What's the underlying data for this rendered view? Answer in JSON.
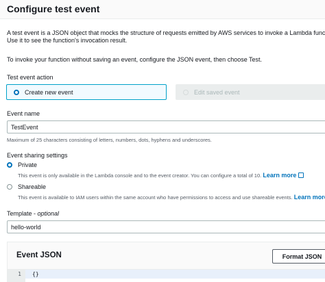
{
  "modal": {
    "title": "Configure test event"
  },
  "intro": {
    "line1": "A test event is a JSON object that mocks the structure of requests emitted by AWS services to invoke a Lambda function.",
    "line2": "Use it to see the function's invocation result.",
    "line3": "To invoke your function without saving an event, configure the JSON event, then choose Test."
  },
  "test_event_action": {
    "label": "Test event action",
    "options": [
      {
        "label": "Create new event",
        "selected": true,
        "disabled": false
      },
      {
        "label": "Edit saved event",
        "selected": false,
        "disabled": true
      }
    ]
  },
  "event_name": {
    "label": "Event name",
    "value": "TestEvent",
    "hint": "Maximum of 25 characters consisting of letters, numbers, dots, hyphens and underscores."
  },
  "sharing": {
    "label": "Event sharing settings",
    "private": {
      "label": "Private",
      "selected": true,
      "description": "This event is only available in the Lambda console and to the event creator. You can configure a total of 10.",
      "link": "Learn more"
    },
    "shareable": {
      "label": "Shareable",
      "selected": false,
      "description": "This event is available to IAM users within the same account who have permissions to access and use shareable events.",
      "link": "Learn more"
    }
  },
  "template": {
    "label": "Template",
    "optional": "optional",
    "value": "hello-world"
  },
  "event_json": {
    "title": "Event JSON",
    "format_button": "Format JSON",
    "line_number": "1",
    "code": "{}"
  },
  "colors": {
    "accent": "#0073bb",
    "selected_tile_border": "#00a1c9",
    "selected_tile_bg": "#f1faff",
    "disabled_bg": "#eaeded"
  }
}
